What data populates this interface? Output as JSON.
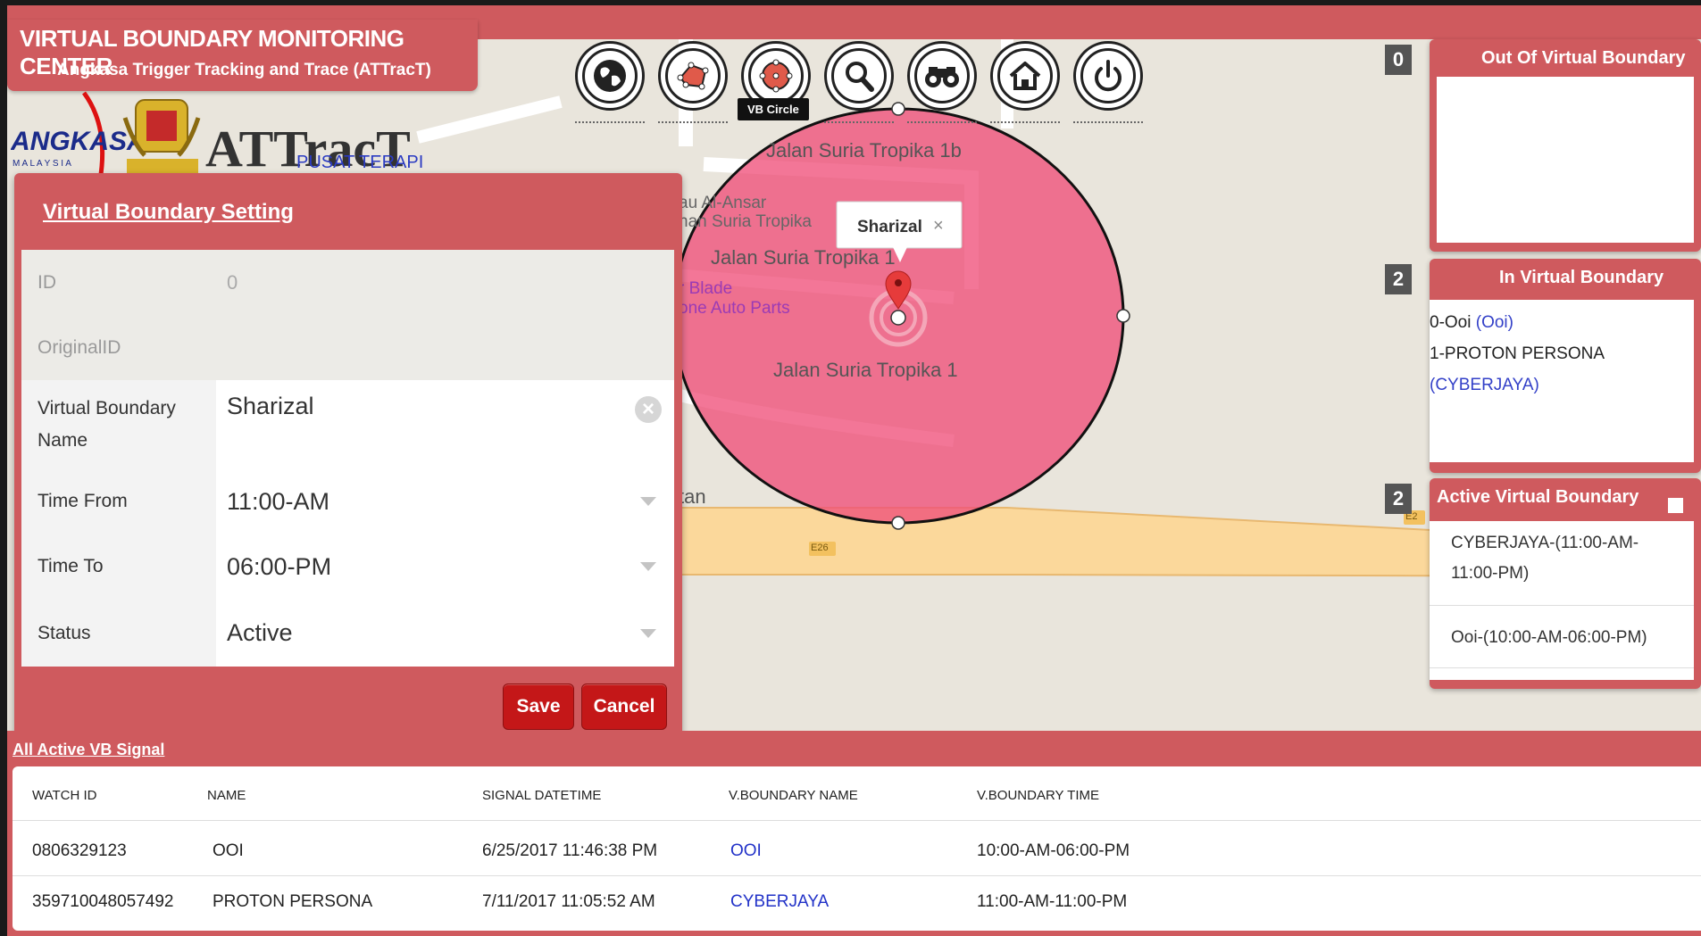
{
  "header": {
    "title": "VIRTUAL BOUNDARY MONITORING CENTER",
    "subtitle": "Angkasa Trigger Tracking and Trace (ATTracT)"
  },
  "logos": {
    "angkasa": "ANGKASA",
    "angkasa_sub": "M A L A Y S I A",
    "attract": "ATTracT",
    "pusat": "PUSAT TERAPI"
  },
  "toolbar": {
    "buttons": [
      {
        "name": "globe",
        "icon": "globe-icon"
      },
      {
        "name": "vb-polygon",
        "icon": "polygon-icon"
      },
      {
        "name": "vb-circle",
        "icon": "circle-icon"
      },
      {
        "name": "search",
        "icon": "search-icon"
      },
      {
        "name": "binoculars",
        "icon": "binoculars-icon"
      },
      {
        "name": "home",
        "icon": "home-icon"
      },
      {
        "name": "power",
        "icon": "power-icon"
      }
    ],
    "tooltip": "VB Circle"
  },
  "map": {
    "streets": [
      "Jalan Suria Tropika 1b",
      "Jalan Suria Tropika 1",
      "Jalan Suria Tropika 1",
      "tan"
    ],
    "poi": [
      "au Al-Ansar",
      "nan Suria Tropika",
      "r Blade",
      "one Auto Parts"
    ],
    "marker_popup": "Sharizal",
    "road_badges": [
      "E26",
      "E2"
    ],
    "circle_color": "#f0507a"
  },
  "form": {
    "title": "Virtual Boundary Setting",
    "fields": {
      "id_label": "ID",
      "id_value": "0",
      "original_label": "OriginalID",
      "original_value": "",
      "name_label_1": "Virtual Boundary",
      "name_label_2": "Name",
      "name_value": "Sharizal",
      "time_from_label": "Time From",
      "time_from_value": "11:00-AM",
      "time_to_label": "Time To",
      "time_to_value": "06:00-PM",
      "status_label": "Status",
      "status_value": "Active"
    },
    "save_label": "Save",
    "cancel_label": "Cancel"
  },
  "right": {
    "out": {
      "count": "0",
      "title": "Out Of Virtual Boundary"
    },
    "in": {
      "count": "2",
      "title": "In Virtual Boundary",
      "items": [
        {
          "prefix": "0-Ooi ",
          "link": "(Ooi)"
        },
        {
          "prefix": "1-PROTON PERSONA",
          "link": "(CYBERJAYA)"
        }
      ]
    },
    "active": {
      "count": "2",
      "title": "Active Virtual Boundary",
      "items": [
        "CYBERJAYA-(11:00-AM-",
        "11:00-PM)",
        "Ooi-(10:00-AM-06:00-PM)"
      ]
    }
  },
  "signals": {
    "title": "All Active VB Signal",
    "columns": [
      "WATCH ID",
      "NAME",
      "SIGNAL DATETIME",
      "V.BOUNDARY NAME",
      "V.BOUNDARY TIME"
    ],
    "rows": [
      [
        "0806329123",
        "OOI",
        "6/25/2017 11:46:38 PM",
        "OOI",
        "10:00-AM-06:00-PM"
      ],
      [
        "359710048057492",
        "PROTON PERSONA",
        "7/11/2017 11:05:52 AM",
        "CYBERJAYA",
        "11:00-AM-11:00-PM"
      ]
    ]
  }
}
